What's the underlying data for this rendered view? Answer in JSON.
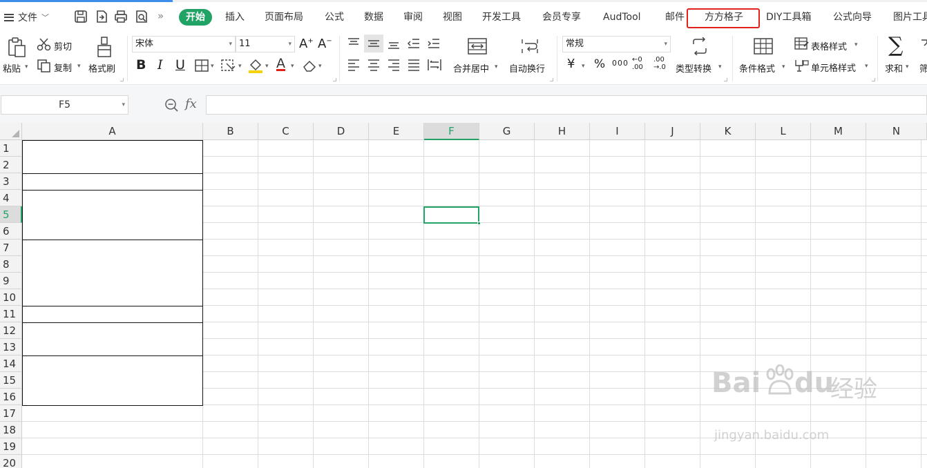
{
  "menubar": {
    "file_label": "文件",
    "tabs": [
      {
        "label": "开始",
        "active": true
      },
      {
        "label": "插入"
      },
      {
        "label": "页面布局"
      },
      {
        "label": "公式"
      },
      {
        "label": "数据"
      },
      {
        "label": "审阅"
      },
      {
        "label": "视图"
      },
      {
        "label": "开发工具"
      },
      {
        "label": "会员专享"
      },
      {
        "label": "AudTool"
      },
      {
        "label": "邮件"
      },
      {
        "label": "方方格子",
        "highlighted": true
      },
      {
        "label": "DIY工具箱"
      },
      {
        "label": "公式向导"
      },
      {
        "label": "图片工具"
      }
    ],
    "more_glyph": "»",
    "accent_color": "#21a366",
    "highlight_color": "#e0201b"
  },
  "ribbon": {
    "paste": "粘贴",
    "cut": "剪切",
    "copy": "复制",
    "format_painter": "格式刷",
    "font_name": "宋体",
    "font_size": "11",
    "merge_center": "合并居中",
    "wrap_text": "自动换行",
    "number_format": "常规",
    "type_convert": "类型转换",
    "conditional_format": "条件格式",
    "table_style": "表格样式",
    "cell_style": "单元格样式",
    "sum": "求和",
    "filter": "筛",
    "bold": "B",
    "italic": "I",
    "underline": "U",
    "font_color_letter": "A",
    "currency": "¥",
    "percent": "%",
    "thousands": "000",
    "dec_inc_top": "←0",
    "dec_inc_bottom": ".00",
    "dec_dec_top": ".00",
    "dec_dec_bottom": "→.0",
    "sigma": "∑"
  },
  "formula_bar": {
    "name_box": "F5",
    "fx_label": "fx",
    "formula": ""
  },
  "sheet": {
    "columns": [
      "A",
      "B",
      "C",
      "D",
      "E",
      "F",
      "G",
      "H",
      "I",
      "J",
      "K",
      "L",
      "M",
      "N"
    ],
    "rows": [
      "1",
      "2",
      "3",
      "4",
      "5",
      "6",
      "7",
      "8",
      "9",
      "10",
      "11",
      "12",
      "13",
      "14",
      "15",
      "16",
      "17",
      "18",
      "19",
      "20"
    ],
    "selected_column": "F",
    "selected_row": "5",
    "merged_ranges_in_A": [
      "A1:A2",
      "A3",
      "A4:A6",
      "A7:A10",
      "A11",
      "A12:A13",
      "A14:A16"
    ]
  },
  "watermark": {
    "brand": "Bai",
    "brand2": "du",
    "cn": "经验",
    "url": "jingyan.baidu.com"
  }
}
